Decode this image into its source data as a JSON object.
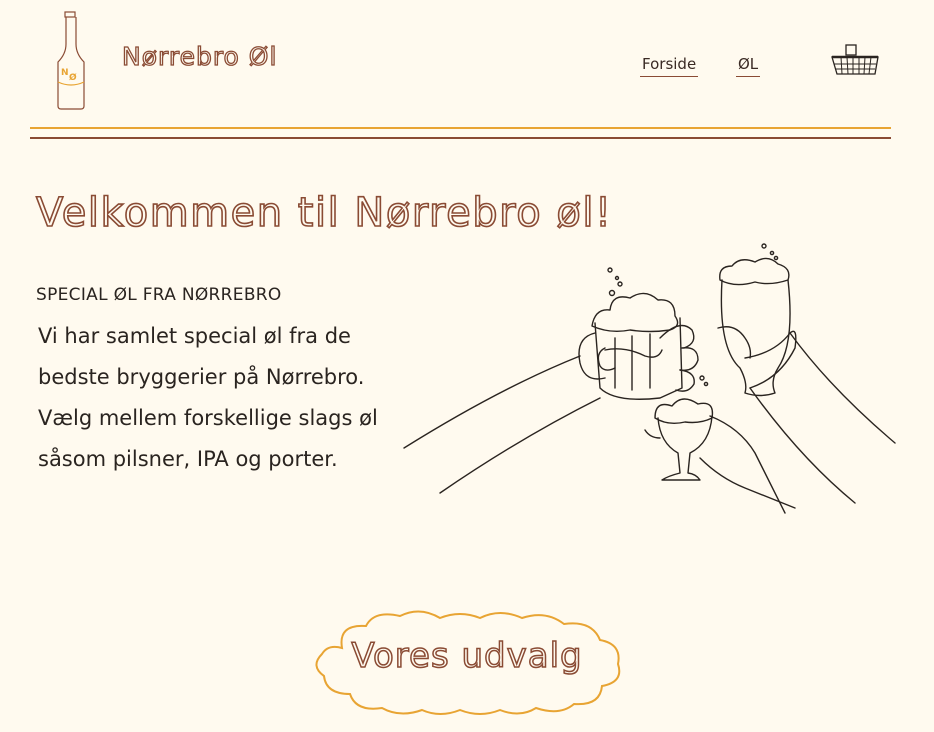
{
  "header": {
    "logo": {
      "icon": "bottle-logo-icon",
      "bottle_mark": "NØ"
    },
    "brand_name": "Nørrebro Øl",
    "nav": [
      {
        "label": "Forside"
      },
      {
        "label": "ØL"
      }
    ],
    "cart": {
      "icon": "basket-icon"
    }
  },
  "hero": {
    "title": "Velkommen til Nørrebro øl!",
    "subtitle": "SPECIAL ØL FRA NØRREBRO",
    "body": "Vi har samlet special øl fra de bedste bryggerier på Nørrebro. Vælg mellem forskellige slags øl såsom pilsner, IPA og porter.",
    "illustration": "cheers-illustration"
  },
  "selection": {
    "label": "Vores udvalg"
  },
  "colors": {
    "background": "#fffaef",
    "brand_brown": "#8a4b34",
    "accent_orange": "#e8a433",
    "text": "#2a2420"
  }
}
